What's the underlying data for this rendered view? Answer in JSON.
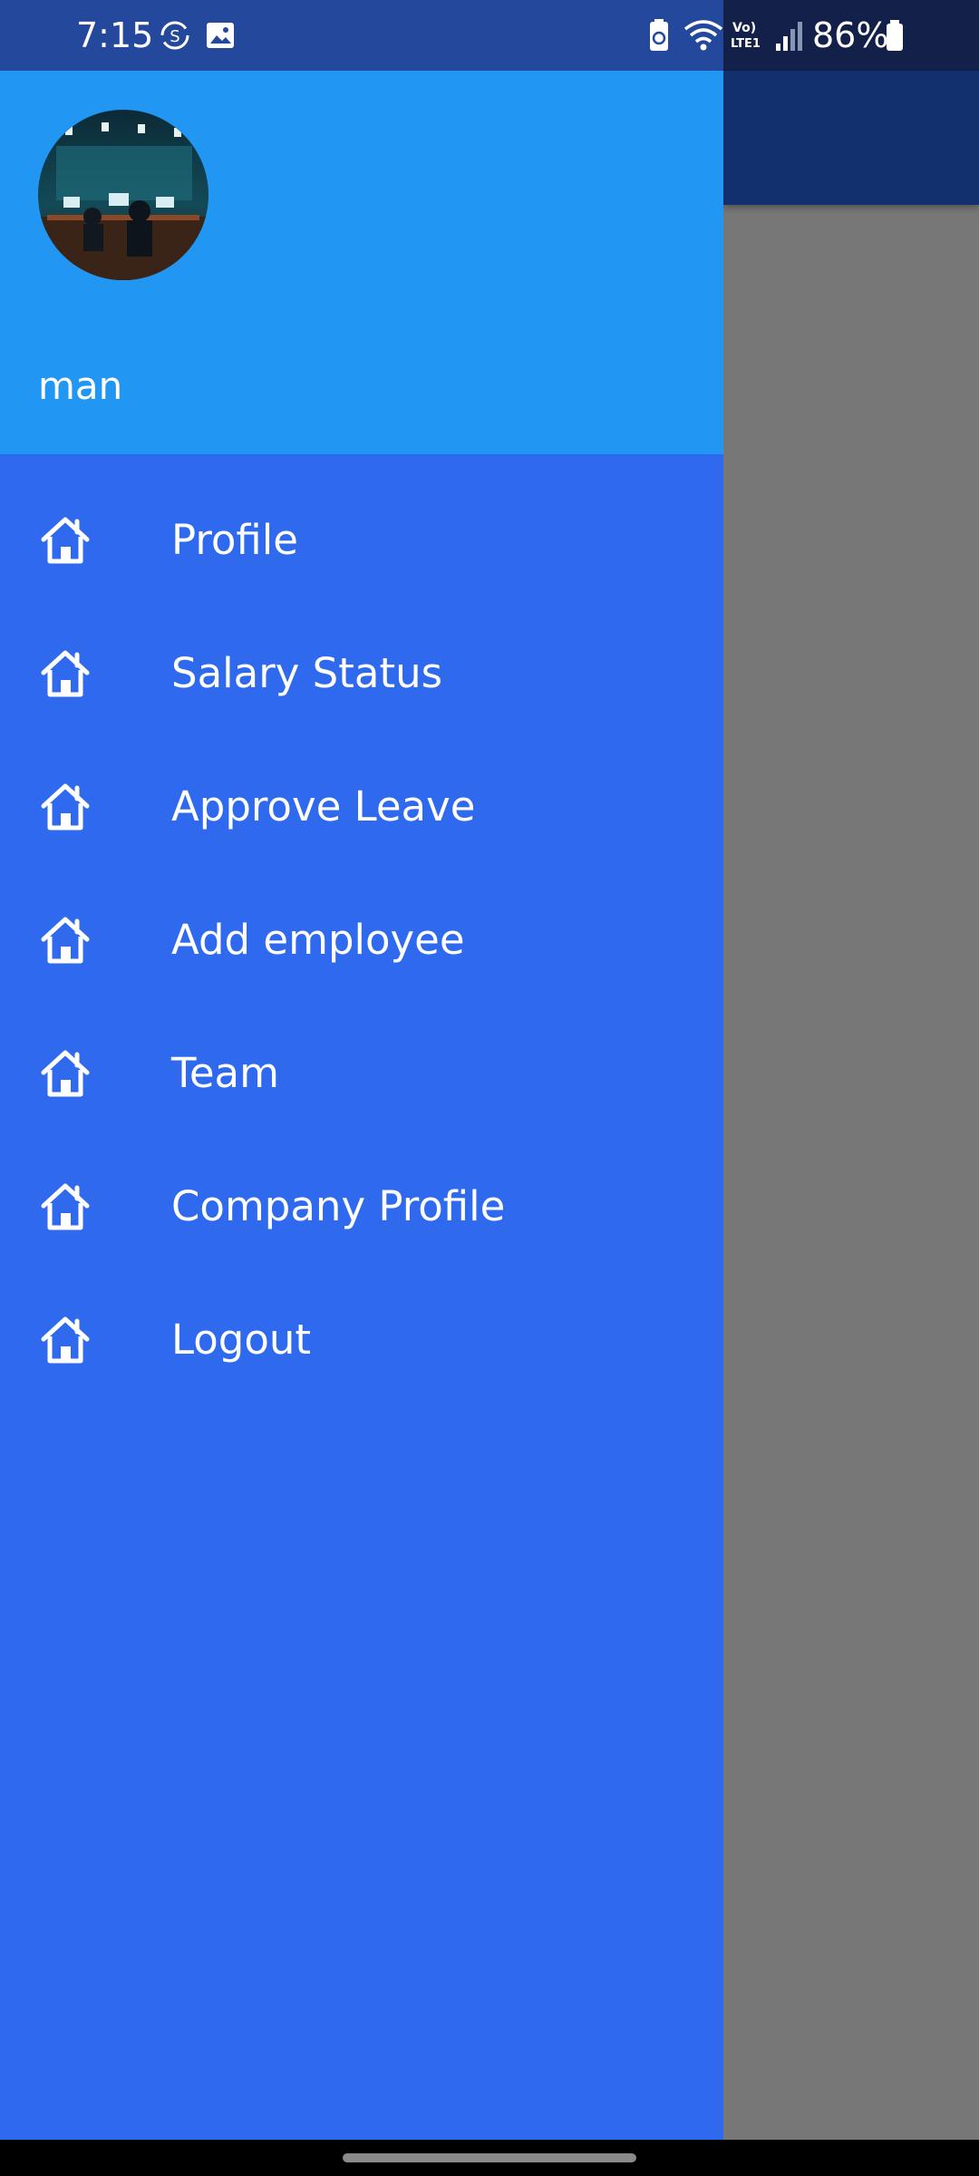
{
  "status_bar": {
    "time": "7:15",
    "battery_percent": "86%",
    "icons": [
      "sync-icon",
      "gallery-icon",
      "battery-saver-icon",
      "wifi-icon",
      "volte-icon",
      "signal-icon",
      "battery-icon"
    ]
  },
  "drawer": {
    "header": {
      "user_name": "man",
      "avatar": "avatar-photo"
    },
    "items": [
      {
        "label": "Profile",
        "icon": "home-icon"
      },
      {
        "label": "Salary Status",
        "icon": "home-icon"
      },
      {
        "label": "Approve Leave",
        "icon": "home-icon"
      },
      {
        "label": "Add employee",
        "icon": "home-icon"
      },
      {
        "label": "Team",
        "icon": "home-icon"
      },
      {
        "label": "Company Profile",
        "icon": "home-icon"
      },
      {
        "label": "Logout",
        "icon": "home-icon"
      }
    ]
  },
  "colors": {
    "status_bar": "#23489c",
    "drawer_header": "#2196f3",
    "drawer_body": "#2f6aee",
    "scrim": "#777777",
    "app_bar": "#12306e",
    "text": "#ffffff"
  }
}
